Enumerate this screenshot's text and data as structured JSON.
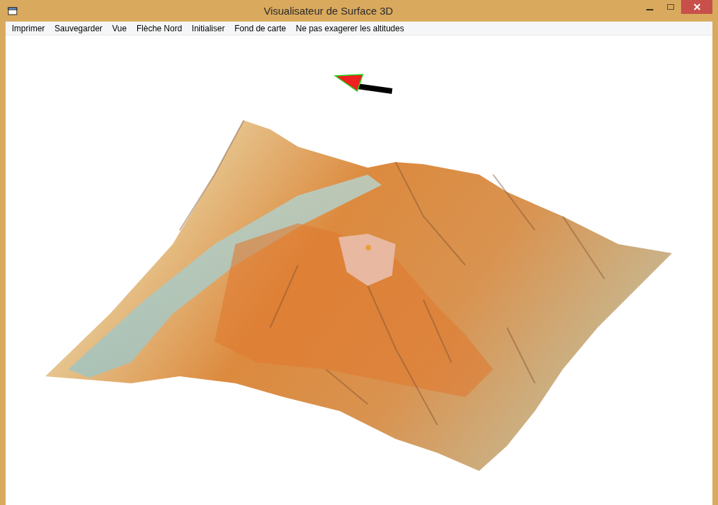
{
  "window": {
    "title": "Visualisateur de Surface 3D"
  },
  "menu": [
    {
      "label": "Imprimer"
    },
    {
      "label": "Sauvegarder"
    },
    {
      "label": "Vue"
    },
    {
      "label": "Flèche Nord"
    },
    {
      "label": "Initialiser"
    },
    {
      "label": "Fond de carte"
    },
    {
      "label": "Ne pas exagerer les altitudes"
    }
  ]
}
